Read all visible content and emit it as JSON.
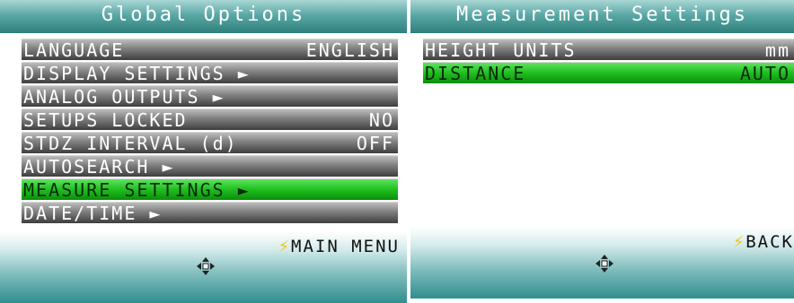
{
  "global_options": {
    "title": "Global Options",
    "items": [
      {
        "label": "LANGUAGE",
        "value": "ENGLISH"
      },
      {
        "label": "DISPLAY SETTINGS ►",
        "value": ""
      },
      {
        "label": "ANALOG OUTPUTS ►",
        "value": ""
      },
      {
        "label": "SETUPS LOCKED",
        "value": "NO"
      },
      {
        "label": "STDZ INTERVAL (d)",
        "value": "OFF"
      },
      {
        "label": "AUTOSEARCH ►",
        "value": ""
      },
      {
        "label": "MEASURE SETTINGS ►",
        "value": ""
      },
      {
        "label": "DATE/TIME ►",
        "value": ""
      }
    ],
    "selected_index": 6,
    "footer_action": "MAIN MENU"
  },
  "measurement_settings": {
    "title": "Measurement Settings",
    "items": [
      {
        "label": "HEIGHT UNITS",
        "value": "mm"
      },
      {
        "label": "DISTANCE",
        "value": "AUTO"
      }
    ],
    "selected_index": 1,
    "footer_action": "BACK"
  },
  "icons": {
    "action": "lightning-bolt-icon",
    "nav": "four-way-dpad-icon"
  },
  "colors": {
    "title_teal": "#5aa8a6",
    "selected_green": "#1fbf1f",
    "bolt": "#f2c400"
  }
}
